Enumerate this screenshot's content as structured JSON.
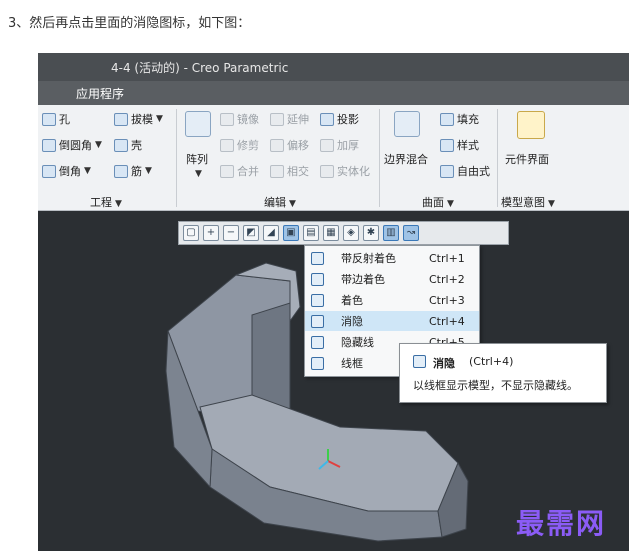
{
  "caption": "3、然后再点击里面的消隐图标，如下图：",
  "window": {
    "title": "4-4 (活动的) - Creo Parametric"
  },
  "menubar": {
    "applications": "应用程序"
  },
  "ribbon": {
    "engineering": {
      "hole": "孔",
      "draft": "拔模",
      "round": "倒圆角",
      "shell": "壳",
      "chamfer": "倒角",
      "rib": "筋",
      "group_label": "工程"
    },
    "editing": {
      "pattern": "阵列",
      "mirror": "镜像",
      "extend": "延伸",
      "project": "投影",
      "trim": "修剪",
      "offset": "偏移",
      "thicken": "加厚",
      "merge": "合并",
      "intersect": "相交",
      "solidify": "实体化",
      "group_label": "编辑"
    },
    "surfaces": {
      "fill": "填充",
      "boundary_blend": "边界混合",
      "style": "样式",
      "freestyle": "自由式",
      "group_label": "曲面"
    },
    "model_intent": {
      "component_interface": "元件界面",
      "group_label": "模型意图"
    }
  },
  "display_style_menu": {
    "items": [
      {
        "label": "带反射着色",
        "shortcut": "Ctrl+1"
      },
      {
        "label": "带边着色",
        "shortcut": "Ctrl+2"
      },
      {
        "label": "着色",
        "shortcut": "Ctrl+3"
      },
      {
        "label": "消隐",
        "shortcut": "Ctrl+4"
      },
      {
        "label": "隐藏线",
        "shortcut": "Ctrl+5"
      },
      {
        "label": "线框",
        "shortcut": ""
      }
    ],
    "highlighted_index": 3
  },
  "tooltip": {
    "title": "消隐",
    "shortcut": "(Ctrl+4)",
    "description": "以线框显示模型，不显示隐藏线。"
  },
  "watermark": "最需网",
  "colors": {
    "viewport_bg": "#2b2f33",
    "titlebar_bg": "#4a4e52",
    "menubar_bg": "#5a5e62",
    "ribbon_bg": "#f0f2f4",
    "highlight": "#cfe6f7",
    "watermark": "#8b5cf6",
    "model_fill": "#8e96a3"
  },
  "icons": [
    "hole-icon",
    "draft-icon",
    "round-icon",
    "shell-icon",
    "chamfer-icon",
    "rib-icon",
    "pattern-icon",
    "mirror-icon",
    "extend-icon",
    "project-icon",
    "trim-icon",
    "offset-icon",
    "thicken-icon",
    "merge-icon",
    "intersect-icon",
    "solidify-icon",
    "boundary-blend-icon",
    "fill-icon",
    "style-icon",
    "freestyle-icon",
    "component-interface-icon",
    "zoom-fit-icon",
    "zoom-in-icon",
    "zoom-out-icon",
    "repaint-icon",
    "view-orient-icon",
    "display-style-icon",
    "saved-views-icon",
    "view-manager-icon",
    "perspective-icon",
    "datum-display-icon",
    "annotation-display-icon"
  ]
}
